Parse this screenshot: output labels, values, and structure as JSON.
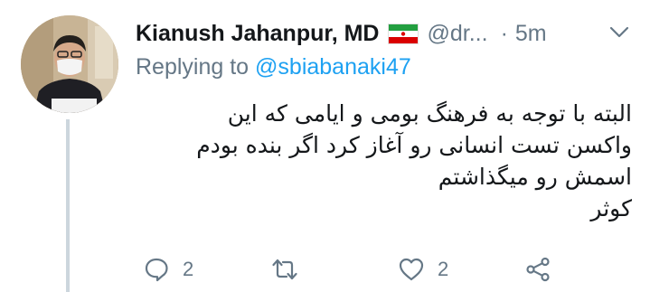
{
  "tweet": {
    "author_name": "Kianush Jahanpur, MD",
    "flag_icon": "iran-flag-icon",
    "handle": "@dr...",
    "separator": "·",
    "time": "5m",
    "replying_prefix": "Replying to ",
    "replying_to": "@sbiabanaki47",
    "body_lines": [
      "البته با توجه به فرهنگ بومی و ایامی که این",
      "واکسن تست انسانی رو آغاز کرد اگر بنده بودم",
      "اسمش رو میگذاشتم",
      "کوثر"
    ]
  },
  "actions": {
    "reply_count": "2",
    "retweet_count": "",
    "like_count": "2"
  },
  "colors": {
    "accent": "#1da1f2",
    "muted": "#657786",
    "text": "#14171a",
    "thread_line": "#ccd6dd"
  }
}
